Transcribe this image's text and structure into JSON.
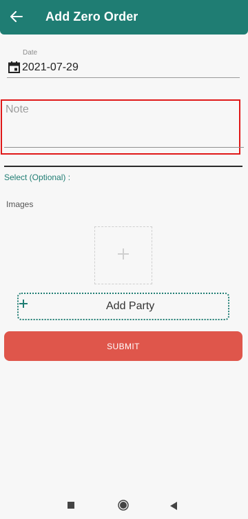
{
  "header": {
    "title": "Add Zero Order",
    "back_icon": "arrow-left-icon",
    "background": "#1f7d73"
  },
  "form": {
    "date": {
      "label": "Date",
      "value": "2021-07-29",
      "icon": "calendar-icon"
    },
    "note": {
      "placeholder": "Note",
      "value": ""
    },
    "select_label": "Select (Optional) :",
    "images_label": "Images",
    "add_image_icon": "plus-icon",
    "add_party": {
      "label": "Add Party",
      "icon": "plus-icon"
    },
    "submit_label": "SUBMIT",
    "submit_color": "#df564b"
  },
  "system_nav": {
    "recents_icon": "square-icon",
    "home_icon": "circle-icon",
    "back_icon": "triangle-back-icon"
  }
}
